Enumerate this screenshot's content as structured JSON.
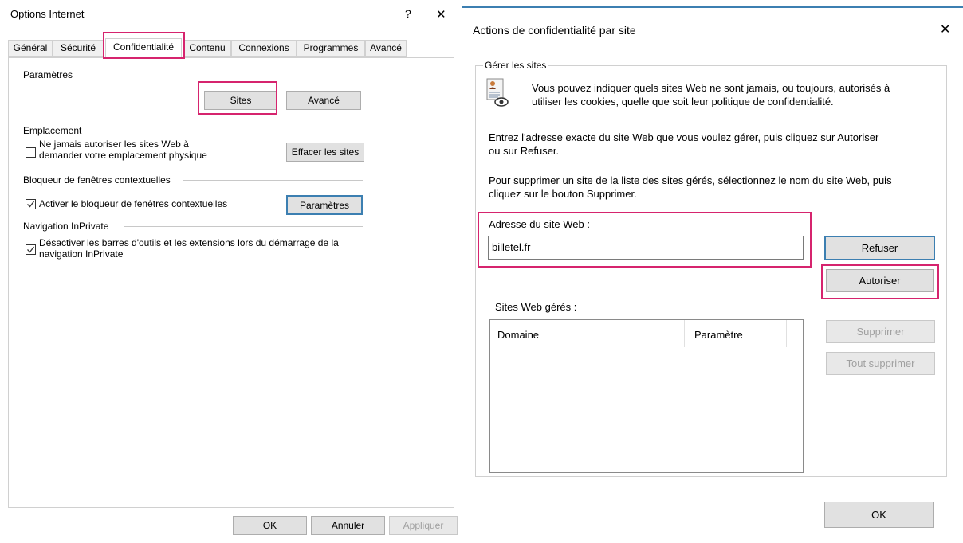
{
  "left_dialog": {
    "title": "Options Internet",
    "help_glyph": "?",
    "close_glyph": "✕",
    "tabs": [
      "Général",
      "Sécurité",
      "Confidentialité",
      "Contenu",
      "Connexions",
      "Programmes",
      "Avancé"
    ],
    "active_tab": "Confidentialité",
    "parametres": {
      "heading": "Paramètres",
      "sites_button": "Sites",
      "avance_button": "Avancé"
    },
    "emplacement": {
      "heading": "Emplacement",
      "checkbox_line1": "Ne jamais autoriser les sites Web à",
      "checkbox_line2": "demander votre emplacement physique",
      "checked": false,
      "clear_button": "Effacer les sites"
    },
    "bloqueur": {
      "heading": "Bloqueur de fenêtres contextuelles",
      "checkbox_label": "Activer le bloqueur de fenêtres contextuelles",
      "checked": true,
      "settings_button": "Paramètres"
    },
    "inprivate": {
      "heading": "Navigation InPrivate",
      "checkbox_line1": "Désactiver les barres d'outils et les extensions lors du démarrage de la",
      "checkbox_line2": "navigation InPrivate",
      "checked": true
    },
    "footer": {
      "ok": "OK",
      "cancel": "Annuler",
      "apply": "Appliquer"
    }
  },
  "right_dialog": {
    "title": "Actions de confidentialité par site",
    "close_glyph": "✕",
    "group_title": "Gérer les sites",
    "intro_line1": "Vous pouvez indiquer quels sites Web ne sont jamais, ou toujours, autorisés à",
    "intro_line2": "utiliser les cookies, quelle que soit leur politique de confidentialité.",
    "instruction1_line1": "Entrez l'adresse exacte du site Web que vous voulez gérer, puis cliquez sur Autoriser",
    "instruction1_line2": "ou sur Refuser.",
    "instruction2_line1": "Pour supprimer un site de la liste des sites gérés, sélectionnez le nom du site Web, puis",
    "instruction2_line2": "cliquez sur le bouton Supprimer.",
    "address_label": "Adresse du site Web :",
    "address_value": "billetel.fr",
    "refuse_button": "Refuser",
    "allow_button": "Autoriser",
    "managed_label": "Sites Web gérés :",
    "columns": [
      "Domaine",
      "Paramètre"
    ],
    "remove_button": "Supprimer",
    "remove_all_button": "Tout supprimer",
    "ok_button": "OK"
  },
  "colors": {
    "highlight": "#d6246e",
    "focus_blue": "#3c7fb1",
    "title_accent": "#3c7fb1"
  }
}
